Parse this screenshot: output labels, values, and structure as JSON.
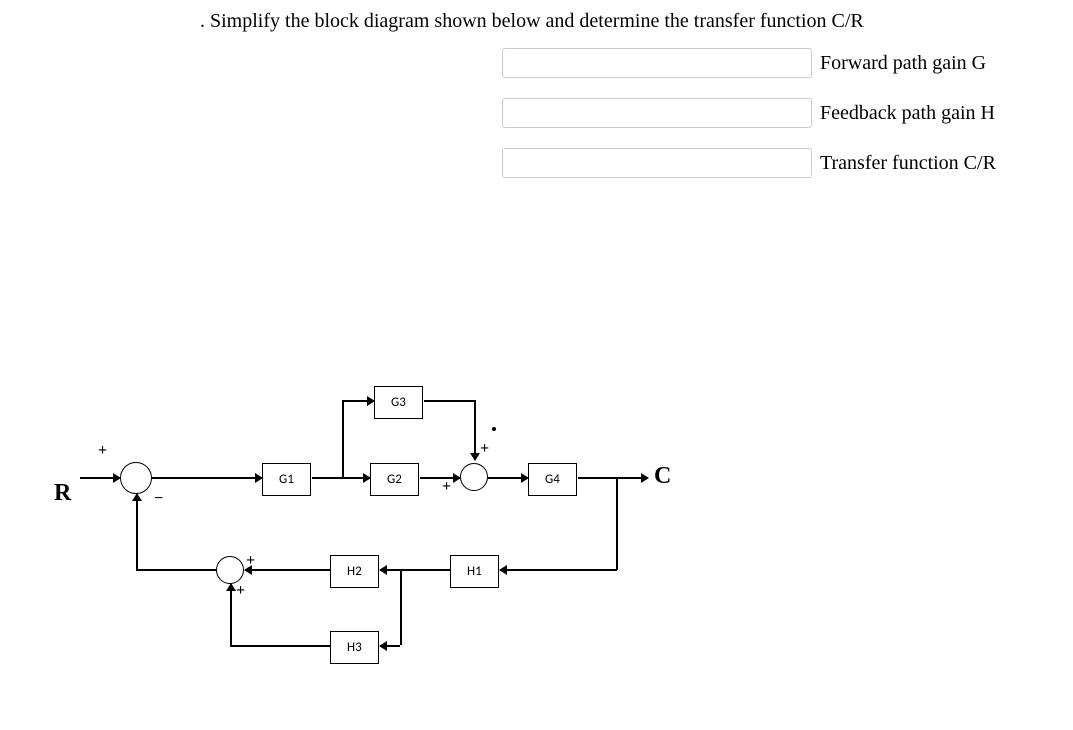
{
  "question": ". Simplify the block diagram shown below and  determine the transfer function   C/R",
  "answers": {
    "forward_gain": {
      "label": "Forward path gain G",
      "value": ""
    },
    "feedback_gain": {
      "label": "Feedback path gain H",
      "value": ""
    },
    "transfer_function": {
      "label": "Transfer function C/R",
      "value": ""
    }
  },
  "diagram": {
    "input_label": "R",
    "output_label": "C",
    "blocks": {
      "g1": "G1",
      "g2": "G2",
      "g3": "G3",
      "g4": "G4",
      "h1": "H1",
      "h2": "H2",
      "h3": "H3"
    },
    "signs": {
      "sum1_plus": "+",
      "sum1_minus": "−",
      "sum2_plus_top": "+",
      "sum2_plus_left": "+",
      "sum3_plus_top": "+",
      "sum3_plus_bottom": "+"
    }
  }
}
